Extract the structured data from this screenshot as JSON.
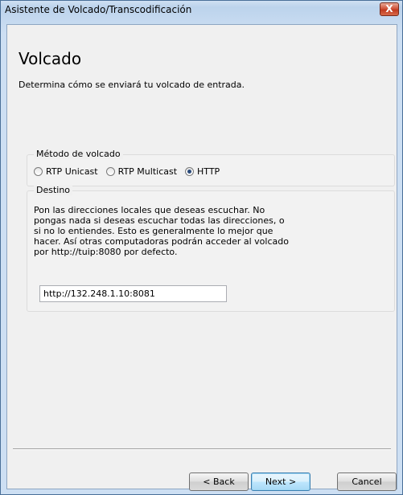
{
  "window": {
    "title": "Asistente de Volcado/Transcodificación",
    "close_glyph": "X"
  },
  "page": {
    "title": "Volcado",
    "subtitle": "Determina cómo se enviará tu volcado de entrada."
  },
  "method_group": {
    "legend": "Método de volcado",
    "options": [
      {
        "label": "RTP Unicast",
        "checked": false
      },
      {
        "label": "RTP Multicast",
        "checked": false
      },
      {
        "label": "HTTP",
        "checked": true
      }
    ]
  },
  "destination_group": {
    "legend": "Destino",
    "description": "Pon las direcciones locales que deseas escuchar. No\npongas nada si deseas escuchar todas las direcciones, o\nsi no lo entiendes. Esto es generalmente lo mejor que\nhacer. Así otras computadoras podrán acceder al volcado\npor http://tuip:8080 por defecto.",
    "address_value": "http://132.248.1.10:8081"
  },
  "buttons": {
    "back": "< Back",
    "next": "Next >",
    "cancel": "Cancel"
  },
  "colors": {
    "title_bar": "#cddff3",
    "client_bg": "#f0f0f0",
    "close_button": "#c13a20",
    "default_button_border": "#3c7fb1"
  }
}
